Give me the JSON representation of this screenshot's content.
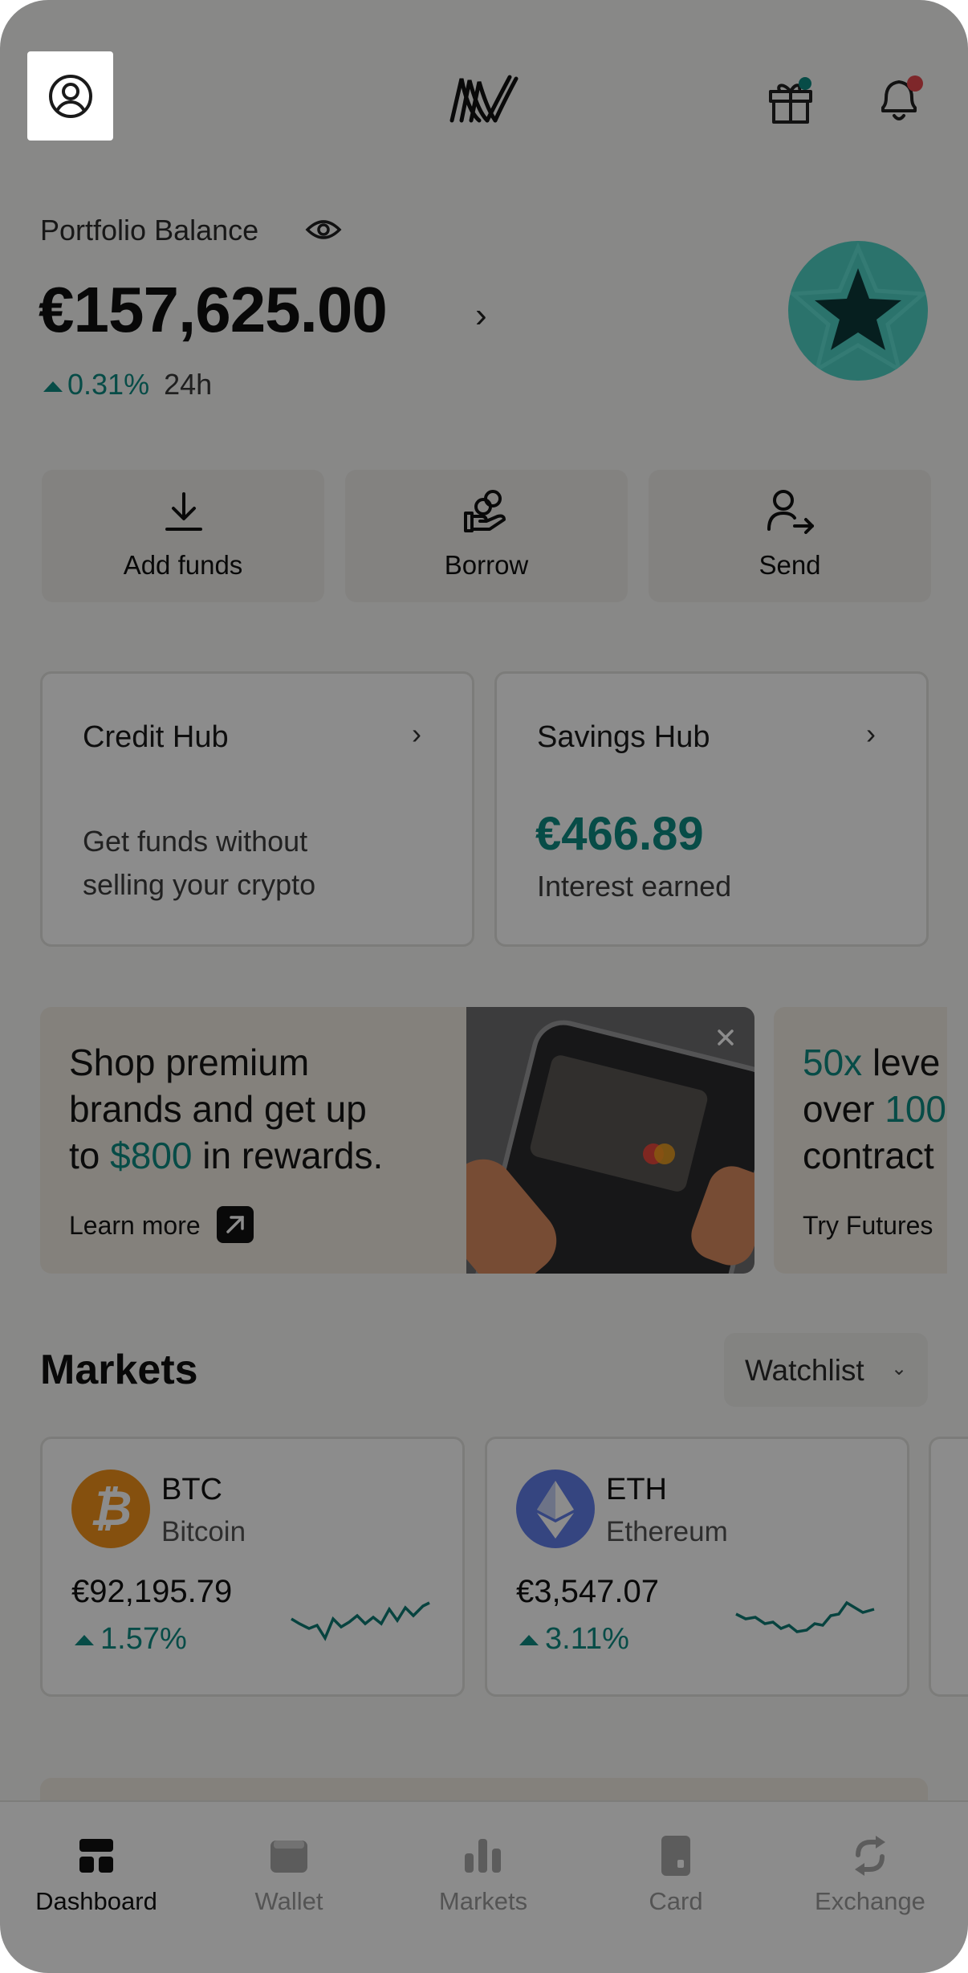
{
  "header": {
    "profile_icon": "user-circle-icon",
    "logo": "nexo-logo",
    "gift_icon": "gift-icon",
    "bell_icon": "bell-icon"
  },
  "portfolio": {
    "label": "Portfolio Balance",
    "balance": "€157,625.00",
    "change": "0.31%",
    "period": "24h",
    "badge_icon": "star-icon"
  },
  "actions": [
    {
      "label": "Add funds",
      "icon": "download-icon"
    },
    {
      "label": "Borrow",
      "icon": "hand-coins-icon"
    },
    {
      "label": "Send",
      "icon": "user-send-icon"
    }
  ],
  "hubs": {
    "credit": {
      "title": "Credit Hub",
      "desc_line1": "Get funds without",
      "desc_line2": "selling your crypto"
    },
    "savings": {
      "title": "Savings Hub",
      "amount": "€466.89",
      "desc": "Interest earned"
    }
  },
  "promos": [
    {
      "line1": "Shop premium",
      "line2": "brands and get up",
      "line3_pre": "to ",
      "line3_highlight": "$800",
      "line3_post": " in rewards.",
      "link": "Learn more"
    },
    {
      "line1_highlight": "50x",
      "line1_post": " leve",
      "line2_pre": "over ",
      "line2_highlight": "100",
      "line3": "contract",
      "link": "Try Futures"
    }
  ],
  "markets": {
    "title": "Markets",
    "filter": "Watchlist",
    "items": [
      {
        "symbol": "BTC",
        "name": "Bitcoin",
        "price": "€92,195.79",
        "change": "1.57%"
      },
      {
        "symbol": "ETH",
        "name": "Ethereum",
        "price": "€3,547.07",
        "change": "3.11%"
      }
    ]
  },
  "nav": {
    "items": [
      {
        "label": "Dashboard",
        "active": true,
        "icon": "dashboard-icon"
      },
      {
        "label": "Wallet",
        "active": false,
        "icon": "wallet-icon"
      },
      {
        "label": "Markets",
        "active": false,
        "icon": "bar-chart-icon"
      },
      {
        "label": "Card",
        "active": false,
        "icon": "card-icon"
      },
      {
        "label": "Exchange",
        "active": false,
        "icon": "exchange-icon"
      }
    ]
  },
  "colors": {
    "accent": "#0e8a82",
    "btc": "#f2931a",
    "eth": "#627eea",
    "badge": "#4fd1c5",
    "notification_dot": "#e5484d"
  }
}
